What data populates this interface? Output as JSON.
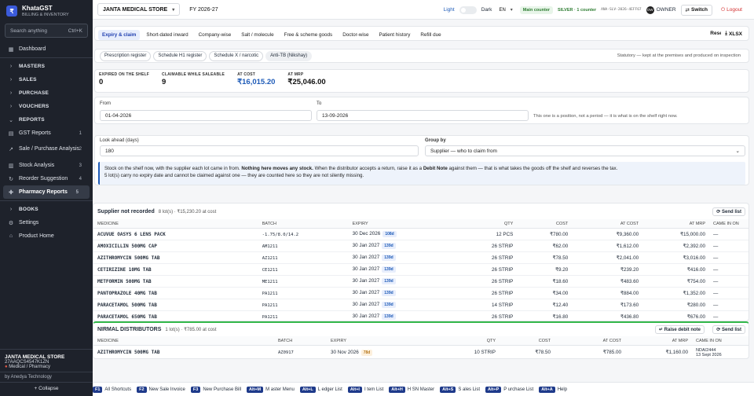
{
  "sidebar": {
    "brand_name": "KhataGST",
    "brand_sub": "BILLING & INVENTORY",
    "search_placeholder": "Search anything",
    "search_shortcut": "Ctrl+K",
    "items": [
      {
        "label": "Dashboard",
        "icon": "grid-icon"
      },
      {
        "label": "MASTERS",
        "group": true
      },
      {
        "label": "SALES",
        "group": true
      },
      {
        "label": "PURCHASE",
        "group": true
      },
      {
        "label": "VOUCHERS",
        "group": true
      },
      {
        "label": "REPORTS",
        "group": true,
        "open": true
      },
      {
        "label": "GST Reports",
        "num": "1"
      },
      {
        "label": "Sale / Purchase Analysis",
        "num": "2"
      },
      {
        "label": "Stock Analysis",
        "num": "3"
      },
      {
        "label": "Reorder Suggestion",
        "num": "4"
      },
      {
        "label": "Pharmacy Reports",
        "num": "5",
        "active": true
      },
      {
        "label": "BOOKS",
        "group": true
      },
      {
        "label": "Settings"
      },
      {
        "label": "Product Home"
      }
    ],
    "firm_name": "JANTA MEDICAL STORE",
    "firm_gstin": "27AAQCS4547K1ZN",
    "firm_type": "Medical / Pharmacy",
    "by": "by Anedya Technology",
    "collapse": "+ Collapse"
  },
  "topbar": {
    "store": "JANTA MEDICAL STORE",
    "fy": "FY 2026-27",
    "light": "Light",
    "dark": "Dark",
    "lang": "EN",
    "counter": "Main counter",
    "license": "SILVER · 1 counter",
    "license_id": "ANA-SLV-2026-4EFF67",
    "avatar": "OW",
    "owner": "OWNER",
    "switch": "Switch",
    "logout": "Logout"
  },
  "tabs": [
    "Expiry & claim",
    "Short-dated inward",
    "Company-wise",
    "Salt / molecule",
    "Free & scheme goods",
    "Doctor-wise",
    "Patient history",
    "Refill due"
  ],
  "reset": "Reset",
  "xls": "XLSX",
  "subtabs": [
    "Prescription register",
    "Schedule H1 register",
    "Schedule X / narcotic",
    "Anti-TB (Nikshay)"
  ],
  "subtab_note": "Statutory — kept at the premises and produced on inspection",
  "stats": [
    {
      "label": "EXPIRED ON THE SHELF",
      "value": "0"
    },
    {
      "label": "CLAIMABLE WHILE SALEABLE",
      "value": "9"
    },
    {
      "label": "AT COST",
      "value": "₹16,015.20",
      "blue": true
    },
    {
      "label": "AT MRP",
      "value": "₹25,046.00"
    }
  ],
  "filters": {
    "from_label": "From",
    "from_value": "01-04-2026",
    "to_label": "To",
    "to_value": "13-09-2026",
    "to_hint": "This one is a position, not a period — it is what is on the shelf right now.",
    "look_label": "Look ahead (days)",
    "look_value": "180",
    "group_label": "Group by",
    "group_value": "Supplier — who to claim from"
  },
  "info": {
    "p1": "Stock on the shelf now, with the supplier each lot came in from. ",
    "p1b": "Nothing here moves any stock.",
    "p2": " When the distributor accepts a return, raise it as a ",
    "p2b": "Debit Note",
    "p3": " against them — that is what takes the goods off the shelf and reverses the tax.",
    "line2": "5 lot(s) carry no expiry date and cannot be claimed against one — they are counted here so they are not silently missing."
  },
  "columns": [
    "MEDICINE",
    "BATCH",
    "EXPIRY",
    "QTY",
    "COST",
    "AT COST",
    "AT MRP",
    "CAME IN ON"
  ],
  "group1": {
    "title": "Supplier not recorded",
    "sub": "8 lot(s) · ₹15,230.20 at cost",
    "send": "Send list",
    "rows": [
      {
        "medicine": "ACUVUE OASYS 6 LENS PACK",
        "batch": "-1.75/8.0/14.2",
        "expiry": "30 Dec 2026",
        "days": "108d",
        "qty": "12 PCS",
        "cost": "₹780.00",
        "at_cost": "₹9,360.00",
        "at_mrp": "₹15,000.00",
        "came": "—"
      },
      {
        "medicine": "AMOXICILLIN 500MG CAP",
        "batch": "AM1211",
        "expiry": "30 Jan 2027",
        "days": "139d",
        "qty": "26 STRIP",
        "cost": "₹62.00",
        "at_cost": "₹1,612.00",
        "at_mrp": "₹2,392.00",
        "came": "—"
      },
      {
        "medicine": "AZITHROMYCIN 500MG TAB",
        "batch": "AZ1211",
        "expiry": "30 Jan 2027",
        "days": "139d",
        "qty": "26 STRIP",
        "cost": "₹78.50",
        "at_cost": "₹2,041.00",
        "at_mrp": "₹3,016.00",
        "came": "—"
      },
      {
        "medicine": "CETIRIZINE 10MG TAB",
        "batch": "CE1211",
        "expiry": "30 Jan 2027",
        "days": "139d",
        "qty": "26 STRIP",
        "cost": "₹9.20",
        "at_cost": "₹239.20",
        "at_mrp": "₹416.00",
        "came": "—"
      },
      {
        "medicine": "METFORMIN 500MG TAB",
        "batch": "ME1211",
        "expiry": "30 Jan 2027",
        "days": "139d",
        "qty": "26 STRIP",
        "cost": "₹18.60",
        "at_cost": "₹483.60",
        "at_mrp": "₹754.00",
        "came": "—"
      },
      {
        "medicine": "PANTOPRAZOLE 40MG TAB",
        "batch": "PA1211",
        "expiry": "30 Jan 2027",
        "days": "139d",
        "qty": "26 STRIP",
        "cost": "₹34.00",
        "at_cost": "₹884.00",
        "at_mrp": "₹1,352.00",
        "came": "—"
      },
      {
        "medicine": "PARACETAMOL 500MG TAB",
        "batch": "PA1211",
        "expiry": "30 Jan 2027",
        "days": "139d",
        "qty": "14 STRIP",
        "cost": "₹12.40",
        "at_cost": "₹173.60",
        "at_mrp": "₹280.00",
        "came": "—"
      },
      {
        "medicine": "PARACETAMOL 650MG TAB",
        "batch": "PA1211",
        "expiry": "30 Jan 2027",
        "days": "139d",
        "qty": "26 STRIP",
        "cost": "₹16.80",
        "at_cost": "₹436.80",
        "at_mrp": "₹676.00",
        "came": "—"
      }
    ]
  },
  "group2": {
    "title": "NIRMAL DISTRIBUTORS",
    "sub": "1 lot(s) · ₹785.00 at cost",
    "debit": "Raise debit note",
    "send": "Send list",
    "rows": [
      {
        "medicine": "AZITHROMYCIN 500MG TAB",
        "batch": "AZ0917",
        "expiry": "30 Nov 2026",
        "days": "78d",
        "qty": "10 STRIP",
        "cost": "₹78.50",
        "at_cost": "₹785.00",
        "at_mrp": "₹1,160.00",
        "came": "NDA/2444",
        "came2": "13 Sept 2026"
      }
    ]
  },
  "shortcuts": [
    {
      "key": "F1",
      "label": "All Shortcuts"
    },
    {
      "key": "F2",
      "label": "New Sale Invoice"
    },
    {
      "key": "F3",
      "label": "New Purchase Bill"
    },
    {
      "key": "Alt+M",
      "label": "M aster Menu"
    },
    {
      "key": "Alt+L",
      "label": "L edger List"
    },
    {
      "key": "Alt+I",
      "label": "I tem List"
    },
    {
      "key": "Alt+H",
      "label": "H SN Master"
    },
    {
      "key": "Alt+S",
      "label": "S ales List"
    },
    {
      "key": "Alt+P",
      "label": "P urchase List"
    },
    {
      "key": "Alt+A",
      "label": "Help"
    }
  ],
  "colors": {
    "accent": "#1e5bb8",
    "sidebar": "#1e222b",
    "active_green": "#2e7d32",
    "danger": "#d32f2f"
  }
}
